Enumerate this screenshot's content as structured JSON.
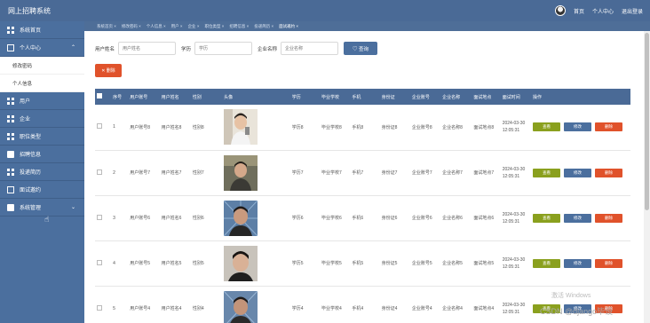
{
  "header": {
    "title": "网上招聘系统",
    "links": [
      "首页",
      "个人中心",
      "退出登录"
    ]
  },
  "sidebar": {
    "items": [
      {
        "label": "系统首页",
        "icon": "home-icon"
      },
      {
        "label": "个人中心",
        "icon": "user-icon",
        "expanded": true
      },
      {
        "label": "修改密码",
        "sub": true
      },
      {
        "label": "个人信息",
        "sub": true
      },
      {
        "label": "用户",
        "icon": "grid-icon"
      },
      {
        "label": "企业",
        "icon": "grid-icon"
      },
      {
        "label": "职位类型",
        "icon": "grid-icon"
      },
      {
        "label": "招聘信息",
        "icon": "message-icon"
      },
      {
        "label": "投递简历",
        "icon": "grid-icon"
      },
      {
        "label": "面试邀约",
        "icon": "box-icon"
      },
      {
        "label": "系统管理",
        "icon": "briefcase-icon",
        "expanded": false
      }
    ]
  },
  "tabs": [
    "系统首页 ×",
    "修改密码 ×",
    "个人信息 ×",
    "用户 ×",
    "企业 ×",
    "职位类型 ×",
    "招聘信息 ×",
    "投递简历 ×",
    "面试邀约 ×"
  ],
  "active_tab": 8,
  "search": {
    "fields": [
      {
        "label": "用户姓名",
        "placeholder": "用户姓名"
      },
      {
        "label": "学历",
        "placeholder": "学历"
      },
      {
        "label": "企业名称",
        "placeholder": "企业名称"
      }
    ],
    "query_label": "♡ 查询"
  },
  "delete_label": "✕ 删除",
  "table": {
    "columns": [
      "",
      "序号",
      "用户账号",
      "用户姓名",
      "性别",
      "头像",
      "学历",
      "毕业学校",
      "手机",
      "身份证",
      "企业账号",
      "企业名称",
      "面试地点",
      "面试时间",
      "操作"
    ],
    "rows": [
      {
        "no": "1",
        "account": "用户账号8",
        "name": "用户姓名8",
        "gender": "性别8",
        "edu": "学历8",
        "school": "毕业学校8",
        "phone": "手机8",
        "idcard": "身份证8",
        "comp_acc": "企业账号8",
        "comp_name": "企业名称8",
        "place": "面试地点8",
        "time": "2024-03-30 12:05:31"
      },
      {
        "no": "2",
        "account": "用户账号7",
        "name": "用户姓名7",
        "gender": "性别7",
        "edu": "学历7",
        "school": "毕业学校7",
        "phone": "手机7",
        "idcard": "身份证7",
        "comp_acc": "企业账号7",
        "comp_name": "企业名称7",
        "place": "面试地点7",
        "time": "2024-03-30 12:05:31"
      },
      {
        "no": "3",
        "account": "用户账号6",
        "name": "用户姓名6",
        "gender": "性别6",
        "edu": "学历6",
        "school": "毕业学校6",
        "phone": "手机6",
        "idcard": "身份证6",
        "comp_acc": "企业账号6",
        "comp_name": "企业名称6",
        "place": "面试地点6",
        "time": "2024-03-30 12:05:31"
      },
      {
        "no": "4",
        "account": "用户账号5",
        "name": "用户姓名5",
        "gender": "性别5",
        "edu": "学历5",
        "school": "毕业学校5",
        "phone": "手机5",
        "idcard": "身份证5",
        "comp_acc": "企业账号5",
        "comp_name": "企业名称5",
        "place": "面试地点5",
        "time": "2024-03-30 12:05:31"
      },
      {
        "no": "5",
        "account": "用户账号4",
        "name": "用户姓名4",
        "gender": "性别4",
        "edu": "学历4",
        "school": "毕业学校4",
        "phone": "手机4",
        "idcard": "身份证4",
        "comp_acc": "企业账号4",
        "comp_name": "企业名称4",
        "place": "面试地点4",
        "time": "2024-03-30 12:05:31"
      }
    ],
    "actions": [
      "查看",
      "修改",
      "删除"
    ]
  },
  "watermark": "激活 Windows",
  "credit": "CSDN @django毕设",
  "colors": {
    "header": "#4a6a96",
    "sidebar": "#4b6f9e",
    "view": "#8aa01e",
    "edit": "#4b6f9e",
    "delete": "#e0522b"
  }
}
